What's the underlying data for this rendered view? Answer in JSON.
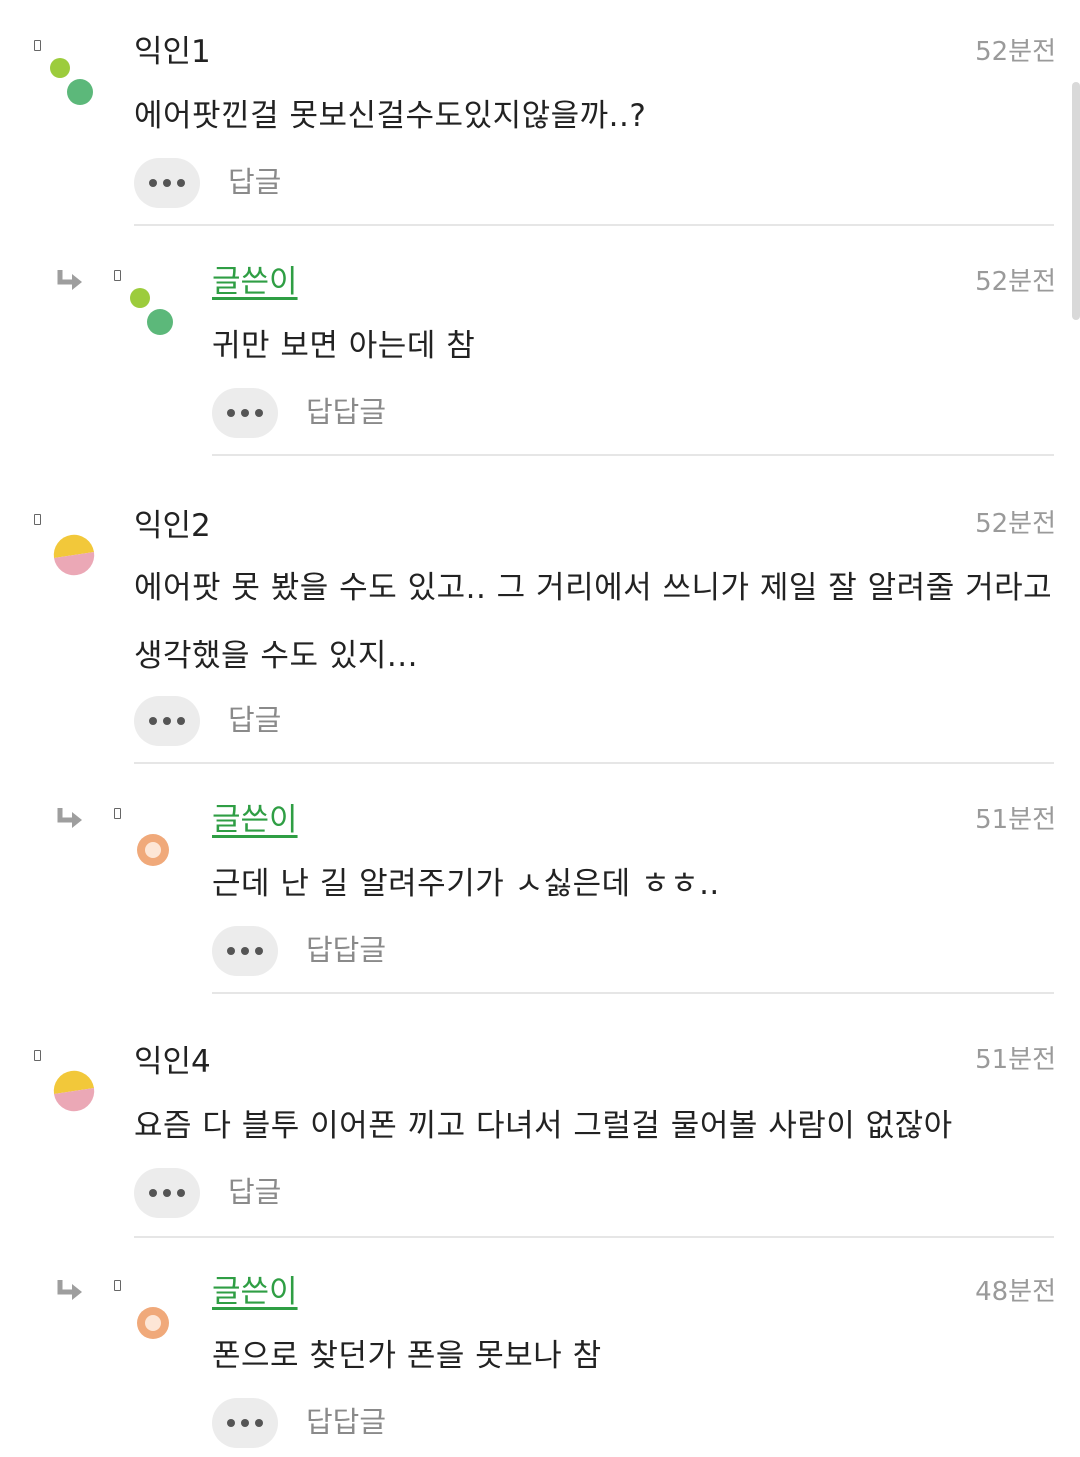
{
  "comments": [
    {
      "author": "익인1",
      "time": "52분전",
      "text": "에어팟낀걸 못보신걸수도있지않을까..?",
      "reply_label": "답글",
      "is_reply": false,
      "is_op": false,
      "avatar": "green-dots"
    },
    {
      "author": "글쓴이",
      "time": "52분전",
      "text": "귀만 보면 아는데 참",
      "reply_label": "답답글",
      "is_reply": true,
      "is_op": true,
      "avatar": "green-dots"
    },
    {
      "author": "익인2",
      "time": "52분전",
      "text": "에어팟 못 봤을 수도 있고.. 그 거리에서 쓰니가 제일 잘 알려줄 거라고 생각했을 수도 있지...",
      "reply_label": "답글",
      "is_reply": false,
      "is_op": false,
      "avatar": "yellow-pink-circle"
    },
    {
      "author": "글쓴이",
      "time": "51분전",
      "text": "근데 난 길 알려주기가 ㅅ싫은데 ㅎㅎ..",
      "reply_label": "답답글",
      "is_reply": true,
      "is_op": true,
      "avatar": "orange-ring"
    },
    {
      "author": "익인4",
      "time": "51분전",
      "text": "요즘 다 블투 이어폰 끼고 다녀서 그럴걸 물어볼 사람이 없잖아",
      "reply_label": "답글",
      "is_reply": false,
      "is_op": false,
      "avatar": "yellow-pink-circle"
    },
    {
      "author": "글쓴이",
      "time": "48분전",
      "text": "폰으로 찾던가 폰을 못보나 참",
      "reply_label": "답답글",
      "is_reply": true,
      "is_op": true,
      "avatar": "orange-ring"
    }
  ],
  "colors": {
    "op_author": "#2f9e44",
    "timestamp": "#9a9a9a",
    "reply_link": "#8a8a8a",
    "more_button_bg": "#ececec",
    "divider": "#e6e6e6"
  },
  "icons": [
    "reply-arrow-icon",
    "marker-icon",
    "more-dots-icon"
  ]
}
